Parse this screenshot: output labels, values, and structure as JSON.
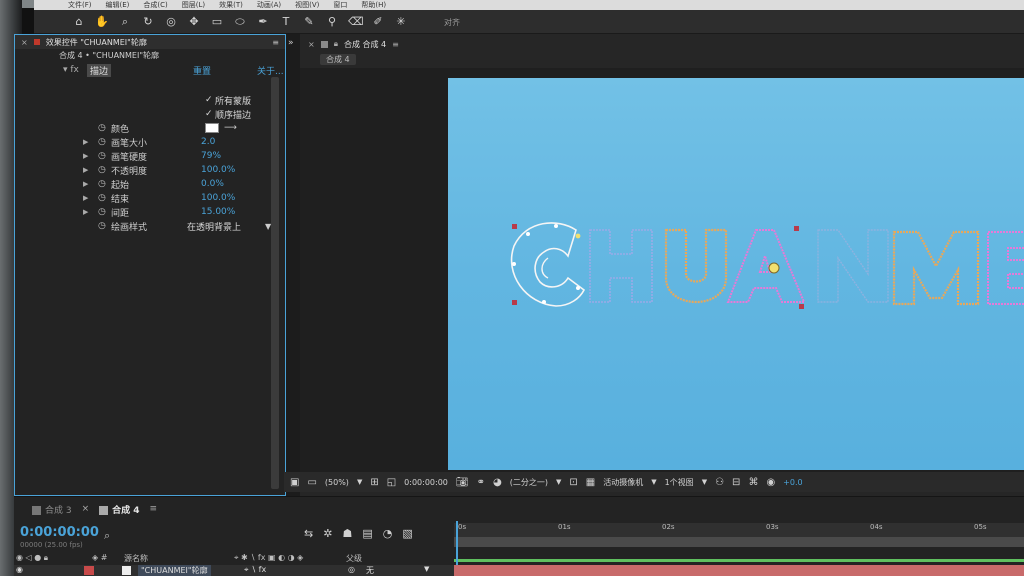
{
  "menu": [
    "文件(F)",
    "编辑(E)",
    "合成(C)",
    "图层(L)",
    "效果(T)",
    "动画(A)",
    "视图(V)",
    "窗口",
    "帮助(H)"
  ],
  "toolbar": {
    "align_label": "对齐"
  },
  "effects_panel": {
    "tab_title": "效果控件 \"CHUANMEI\"轮廓",
    "layer_path": "合成 4 • \"CHUANMEI\"轮廓",
    "fx_name": "描边",
    "reset_label": "重置",
    "about_label": "关于...",
    "all_masks": "所有蒙版",
    "sequential": "顺序描边",
    "props": [
      {
        "label": "颜色",
        "value": ""
      },
      {
        "label": "画笔大小",
        "value": "2.0"
      },
      {
        "label": "画笔硬度",
        "value": "79%"
      },
      {
        "label": "不透明度",
        "value": "100.0%"
      },
      {
        "label": "起始",
        "value": "0.0%"
      },
      {
        "label": "结束",
        "value": "100.0%"
      },
      {
        "label": "间距",
        "value": "15.00%"
      },
      {
        "label": "绘画样式",
        "value": "在透明背景上"
      }
    ],
    "stroke_color": "#ffffff"
  },
  "composition": {
    "tab_title": "合成 合成 4",
    "sub_tab": "合成 4",
    "canvas_color": "#65b8e2",
    "outline_color": "#f0c070",
    "path_color": "#e67ad8"
  },
  "viewer_controls": {
    "zoom": "(50%)",
    "timecode": "0:00:00:00",
    "resolution": "(二分之一)",
    "camera": "活动摄像机",
    "views": "1个视图",
    "exposure": "+0.0"
  },
  "timeline": {
    "tabs": [
      "合成 3",
      "合成 4"
    ],
    "timecode": "0:00:00:00",
    "fps": "00000 (25.00 fps)",
    "ruler": [
      "0s",
      "01s",
      "02s",
      "03s",
      "04s",
      "05s"
    ],
    "col_source": "源名称",
    "col_parent": "父级",
    "layer_name": "\"CHUANMEI\"轮廓",
    "parent_value": "无"
  }
}
